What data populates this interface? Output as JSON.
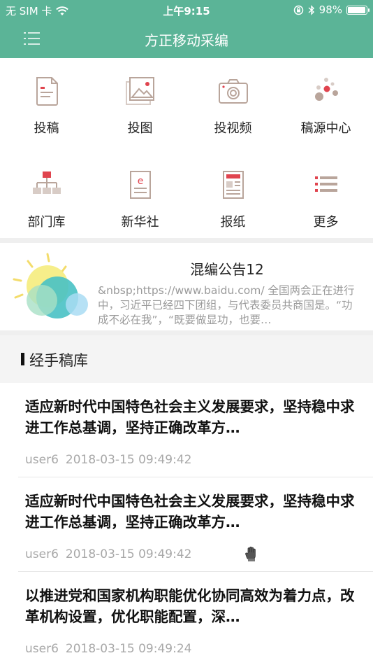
{
  "status_bar": {
    "carrier": "无 SIM 卡",
    "time": "上午9:15",
    "battery_percent": "98%",
    "battery_level": 0.98
  },
  "navbar": {
    "title": "方正移动采编",
    "menu_icon": "menu-icon"
  },
  "grid": {
    "items": [
      {
        "label": "投稿",
        "icon": "document-icon"
      },
      {
        "label": "投图",
        "icon": "image-icon"
      },
      {
        "label": "投视频",
        "icon": "camera-icon"
      },
      {
        "label": "稿源中心",
        "icon": "dots-icon"
      },
      {
        "label": "部门库",
        "icon": "org-chart-icon"
      },
      {
        "label": "新华社",
        "icon": "xinhua-icon"
      },
      {
        "label": "报纸",
        "icon": "newspaper-icon"
      },
      {
        "label": "更多",
        "icon": "list-icon"
      }
    ]
  },
  "notice": {
    "title": "混编公告12",
    "body": "&nbsp;https://www.baidu.com/    全国两会正在进行中，习近平已经四下团组，与代表委员共商国是。“功成不必在我”，“既要做显功，也要…"
  },
  "section": {
    "title": "经手稿库"
  },
  "articles": [
    {
      "title": "适应新时代中国特色社会主义发展要求，坚持稳中求进工作总基调，坚持正确改革方…",
      "author": "user6",
      "datetime": "2018-03-15 09:49:42",
      "has_hand": false
    },
    {
      "title": "适应新时代中国特色社会主义发展要求，坚持稳中求进工作总基调，坚持正确改革方…",
      "author": "user6",
      "datetime": "2018-03-15 09:49:42",
      "has_hand": true
    },
    {
      "title": "以推进党和国家机构职能优化协同高效为着力点，改革机构设置，优化职能配置，深…",
      "author": "user6",
      "datetime": "2018-03-15 09:49:24",
      "has_hand": false
    }
  ],
  "colors": {
    "brand": "#5bb497",
    "accent_red": "#e0444e",
    "icon_brown": "#b9a59b"
  }
}
